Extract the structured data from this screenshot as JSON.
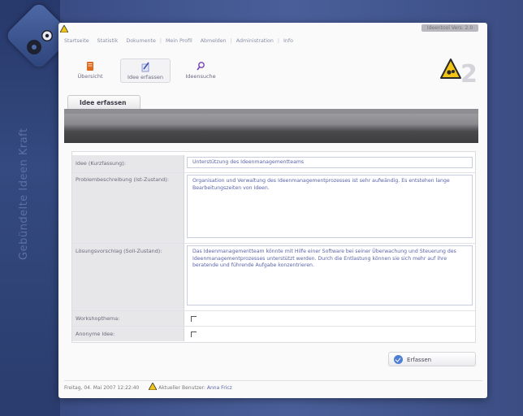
{
  "app": {
    "version": "Ideentool Vers. 2.0",
    "tagline": "Gebündelte Ideen Kraft"
  },
  "topnav": {
    "items": [
      "Startseite",
      "Statistik",
      "Dokumente",
      "Mein Profil",
      "Abmelden",
      "Administration",
      "Info"
    ]
  },
  "toolbar": {
    "items": [
      {
        "label": "Übersicht"
      },
      {
        "label": "Idee erfassen"
      },
      {
        "label": "Ideensuche"
      }
    ]
  },
  "tab": {
    "label": "Idee erfassen"
  },
  "form": {
    "rows": [
      {
        "label": "Idee (Kurzfassung):",
        "value": "Unterstützung des Ideenmanagementteams"
      },
      {
        "label": "Problembeschreibung (Ist-Zustand):",
        "value": "Organisation und Verwaltung des Ideenmanagementprozesses ist sehr aufwändig. Es entstehen lange Bearbeitungszeiten von Ideen."
      },
      {
        "label": "Lösungsvorschlag (Soll-Zustand):",
        "value": "Das Ideenmanagementteam könnte mit Hilfe einer Software bei seiner Überwachung und Steuerung des Ideenmanagementprozesses unterstützt werden. Durch die Entlastung können sie sich mehr auf ihre beratende und führende Aufgabe konzentrieren."
      },
      {
        "label": "Workshopthema:",
        "checked": false
      },
      {
        "label": "Anonyme Idee:",
        "checked": false
      }
    ]
  },
  "submit": {
    "label": "Erfassen"
  },
  "footer": {
    "date": "Freitag, 04. Mai 2007 12:22:40",
    "current_user_label": "Aktueller Benutzer:",
    "current_user": "Anna Fricz"
  },
  "colors": {
    "accent": "#4f7fd0",
    "link": "#5b64a8",
    "brand_yellow": "#f2c416"
  }
}
